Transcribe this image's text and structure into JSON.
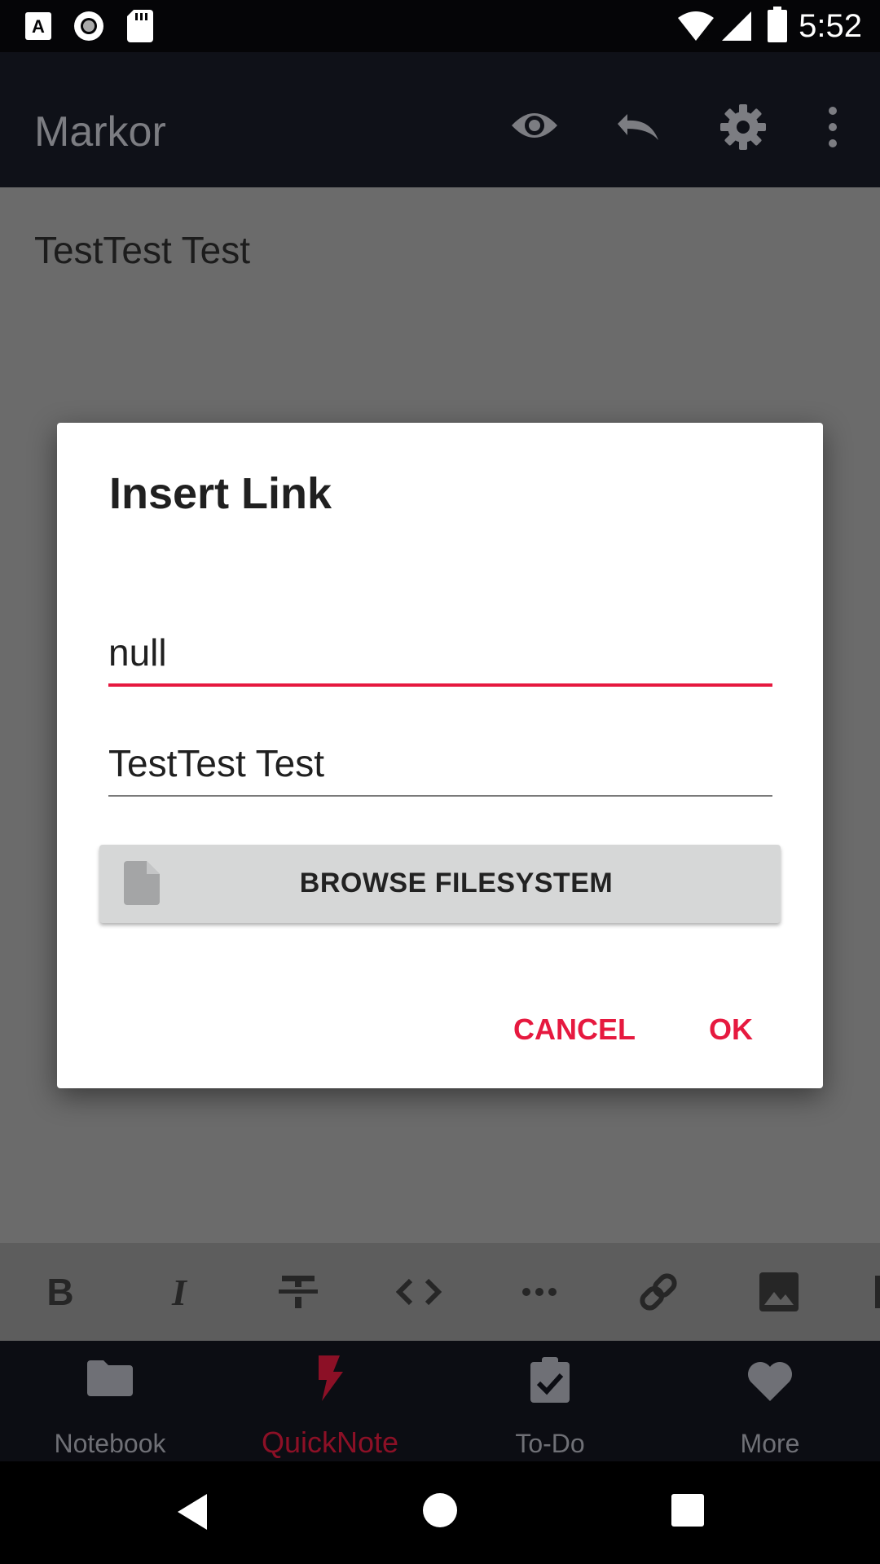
{
  "status_bar": {
    "time": "5:52"
  },
  "app_bar": {
    "title": "Markor"
  },
  "editor": {
    "content": "TestTest Test"
  },
  "dialog": {
    "title": "Insert Link",
    "url_value": "null",
    "title_value": "TestTest Test",
    "browse_label": "BROWSE FILESYSTEM",
    "cancel_label": "CANCEL",
    "ok_label": "OK"
  },
  "bottom_nav": {
    "items": [
      {
        "label": "Notebook",
        "icon": "folder-icon"
      },
      {
        "label": "QuickNote",
        "icon": "lightning-icon",
        "active": true
      },
      {
        "label": "To-Do",
        "icon": "clipboard-check-icon"
      },
      {
        "label": "More",
        "icon": "heart-icon"
      }
    ]
  },
  "colors": {
    "accent": "#e6193f",
    "app_bar": "#0f1118",
    "editor_dimmed": "#6b6b6b"
  }
}
